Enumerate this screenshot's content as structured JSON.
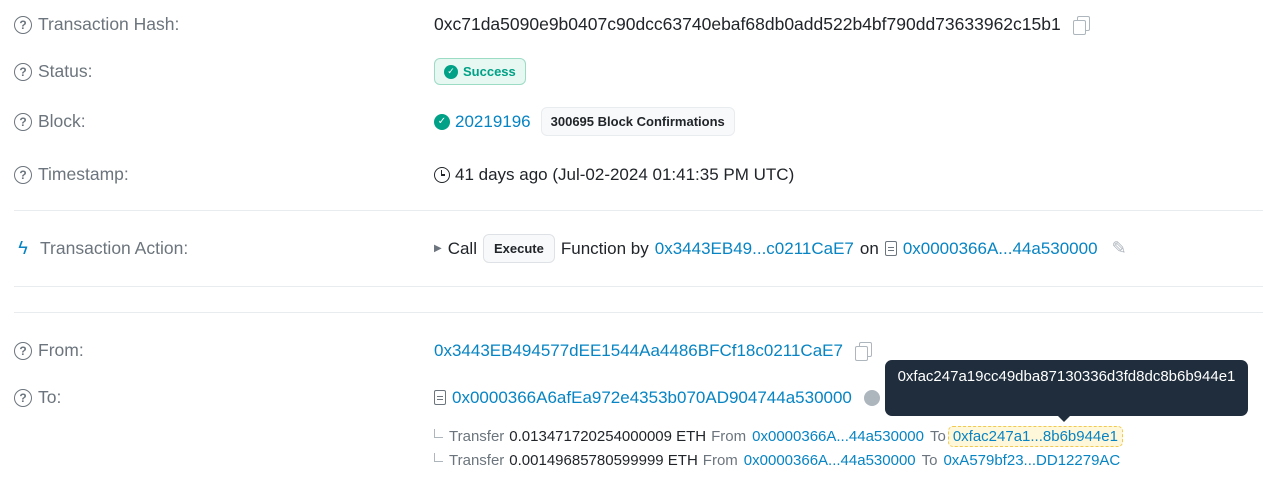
{
  "overview": {
    "tx_hash": {
      "label": "Transaction Hash:",
      "value": "0xc71da5090e9b0407c90dcc63740ebaf68db0add522b4bf790dd73633962c15b1"
    },
    "status": {
      "label": "Status:",
      "value": "Success"
    },
    "block": {
      "label": "Block:",
      "number": "20219196",
      "confirmations": "300695 Block Confirmations"
    },
    "timestamp": {
      "label": "Timestamp:",
      "value": "41 days ago (Jul-02-2024 01:41:35 PM UTC)"
    }
  },
  "action": {
    "label": "Transaction Action:",
    "call": "Call",
    "method": "Execute",
    "function_by": "Function by",
    "caller": "0x3443EB49...c0211CaE7",
    "on": "on",
    "contract": "0x0000366A...44a530000"
  },
  "parties": {
    "from": {
      "label": "From:",
      "value": "0x3443EB494577dEE1544Aa4486BFCf18c0211CaE7"
    },
    "to": {
      "label": "To:",
      "value": "0x0000366A6afEa972e4353b070AD904744a530000"
    }
  },
  "transfers": [
    {
      "word": "Transfer",
      "amount": "0.013471720254000009 ETH",
      "from_word": "From",
      "from": "0x0000366A...44a530000",
      "to_word": "To",
      "to": "0xfac247a1...8b6b944e1"
    },
    {
      "word": "Transfer",
      "amount": "0.00149685780599999 ETH",
      "from_word": "From",
      "from": "0x0000366A...44a530000",
      "to_word": "To",
      "to": "0xA579bf23...DD12279AC"
    }
  ],
  "tooltip": {
    "text": "0xfac247a19cc49dba87130336d3fd8dc8b6b944e1"
  },
  "icons": [
    "question-circle-icon",
    "copy-icon",
    "check-circle-icon",
    "clock-icon",
    "bolt-icon",
    "caret-right-icon",
    "document-icon",
    "pencil-icon",
    "corner-arrow-icon"
  ],
  "colors": {
    "link": "#0784c3",
    "success": "#00a186",
    "muted": "#6c757d",
    "tooltip_bg": "#1f2d3d"
  }
}
